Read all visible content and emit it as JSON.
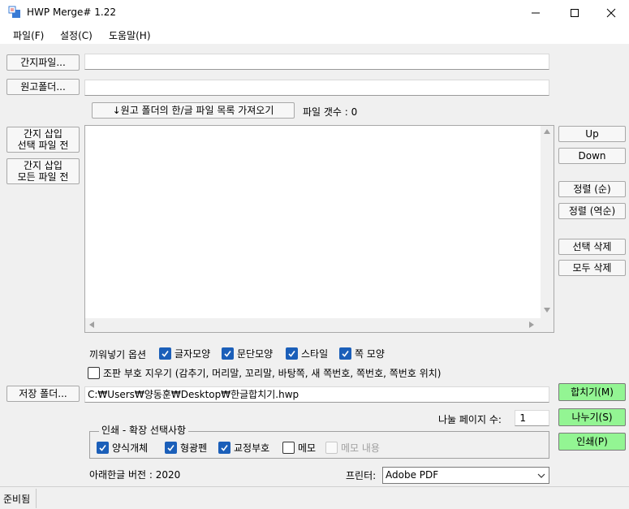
{
  "window": {
    "title": "HWP Merge# 1.22"
  },
  "menu": [
    {
      "label": "파일(F)"
    },
    {
      "label": "설정(C)"
    },
    {
      "label": "도움말(H)"
    }
  ],
  "buttons": {
    "cover_file": "간지파일...",
    "draft_folder": "원고폴더...",
    "fetch_list": "↓원고 폴더의 한/글 파일 목록 가져오기",
    "insert_before_selected": "간지 삽입\n선택 파일 전",
    "insert_before_all": "간지 삽입\n모든 파일 전",
    "up": "Up",
    "down": "Down",
    "sort_asc": "정렬 (순)",
    "sort_desc": "정렬 (역순)",
    "delete_selected": "선택 삭제",
    "delete_all": "모두 삭제",
    "save_folder": "저장 폴더...",
    "merge": "합치기(M)",
    "split": "나누기(S)",
    "print": "인쇄(P)"
  },
  "fields": {
    "cover_file_value": "",
    "draft_folder_value": "",
    "save_path": "C:₩Users₩양동훈₩Desktop₩한글합치기.hwp",
    "split_pages": "1"
  },
  "file_count_label": "파일 갯수 : 0",
  "insert_options": {
    "label": "끼워넣기 옵션",
    "items": [
      {
        "label": "글자모양",
        "checked": true
      },
      {
        "label": "문단모양",
        "checked": true
      },
      {
        "label": "스타일",
        "checked": true
      },
      {
        "label": "쪽 모양",
        "checked": true
      }
    ]
  },
  "remove_codes": {
    "label": "조판 부호 지우기 (감추기, 머리말, 꼬리말, 바탕쪽, 새 쪽번호, 쪽번호, 쪽번호 위치)",
    "checked": false
  },
  "split_label": "나눌 페이지 수:",
  "print_options": {
    "legend": "인쇄 - 확장 선택사항",
    "items": [
      {
        "label": "양식개체",
        "checked": true,
        "enabled": true
      },
      {
        "label": "형광펜",
        "checked": true,
        "enabled": true
      },
      {
        "label": "교정부호",
        "checked": true,
        "enabled": true
      },
      {
        "label": "메모",
        "checked": false,
        "enabled": true
      },
      {
        "label": "메모 내용",
        "checked": false,
        "enabled": false
      }
    ]
  },
  "hangul_version": "아래한글 버전 : 2020",
  "printer": {
    "label": "프린터:",
    "selected": "Adobe PDF"
  },
  "status": "준비됨",
  "icons": {
    "minimize": "minimize-icon",
    "maximize": "maximize-icon",
    "close": "close-icon",
    "check": "check-icon",
    "dropdown": "chevron-down-icon"
  }
}
